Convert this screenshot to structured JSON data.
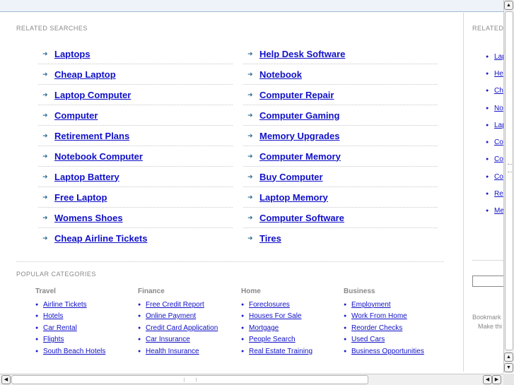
{
  "related_searches": {
    "title": "RELATED SEARCHES",
    "left": [
      "Laptops",
      "Cheap Laptop",
      "Laptop Computer",
      "Computer",
      "Retirement Plans",
      "Notebook Computer",
      "Laptop Battery",
      "Free Laptop",
      "Womens Shoes",
      "Cheap Airline Tickets"
    ],
    "right": [
      "Help Desk Software",
      "Notebook",
      "Computer Repair",
      "Computer Gaming",
      "Memory Upgrades",
      "Computer Memory",
      "Buy Computer",
      "Laptop Memory",
      "Computer Software",
      "Tires"
    ]
  },
  "popular_categories": {
    "title": "POPULAR CATEGORIES",
    "groups": [
      {
        "heading": "Travel",
        "items": [
          "Airline Tickets",
          "Hotels",
          "Car Rental",
          "Flights",
          "South Beach Hotels"
        ]
      },
      {
        "heading": "Finance",
        "items": [
          "Free Credit Report",
          "Online Payment",
          "Credit Card Application",
          "Car Insurance",
          "Health Insurance"
        ]
      },
      {
        "heading": "Home",
        "items": [
          "Foreclosures",
          "Houses For Sale",
          "Mortgage",
          "People Search",
          "Real Estate Training"
        ]
      },
      {
        "heading": "Business",
        "items": [
          "Employment",
          "Work From Home",
          "Reorder Checks",
          "Used Cars",
          "Business Opportunities"
        ]
      }
    ]
  },
  "sidebar": {
    "title": "RELATED",
    "items": [
      "Lap",
      "He",
      "Ch",
      "No",
      "Lap",
      "Co",
      "Co",
      "Co",
      "Re",
      "Me"
    ],
    "bookmark_text": "Bookmark",
    "make_text": "Make thi"
  },
  "scrollbars": {
    "up_glyph": "▲",
    "down_glyph": "▼",
    "left_glyph": "◀",
    "right_glyph": "▶"
  }
}
